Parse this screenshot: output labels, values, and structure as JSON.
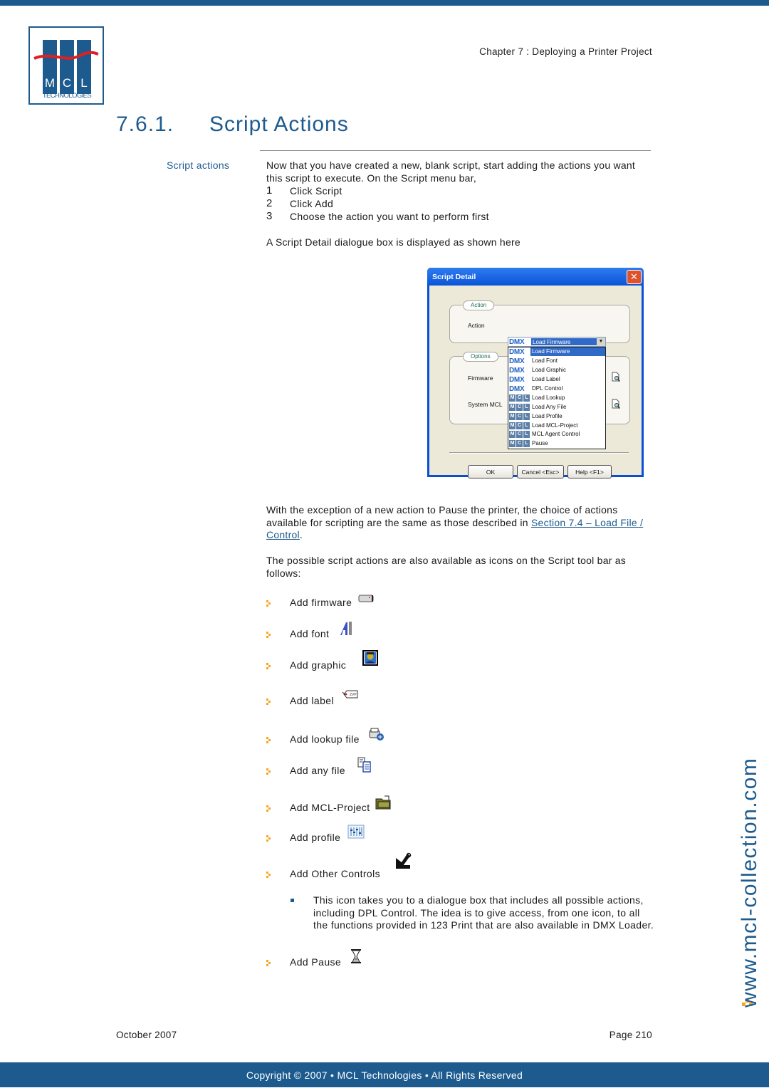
{
  "header": {
    "logo": {
      "letters": [
        "M",
        "C",
        "L"
      ],
      "subtitle": "TECHNOLOGIES"
    },
    "running_head": "Chapter 7 : Deploying a Printer Project"
  },
  "section": {
    "number": "7.6.1.",
    "title": "Script Actions",
    "side_label": "Script actions"
  },
  "intro": {
    "paragraph": "Now that you have created a new, blank script, start adding the actions you want this script to execute. On the Script menu bar,",
    "steps": [
      {
        "num": "1",
        "text": "Click Script"
      },
      {
        "num": "2",
        "text": "Click Add"
      },
      {
        "num": "3",
        "text": "Choose the action you want to perform first"
      }
    ],
    "dialog_caption": "A Script Detail dialogue box is displayed as shown here"
  },
  "dialog": {
    "title": "Script Detail",
    "close_glyph": "✕",
    "action_group_label": "Action",
    "action_label": "Action",
    "selected_action": {
      "badge": "DMX",
      "text": "Load Firmware"
    },
    "options_group_label": "Options",
    "firmware_label": "Firmware",
    "system_mcl_label": "System MCL",
    "dropdown_items": [
      {
        "badge": "DMX",
        "text": "Load Firmware",
        "selected": true
      },
      {
        "badge": "DMX",
        "text": "Load Font"
      },
      {
        "badge": "DMX",
        "text": "Load Graphic"
      },
      {
        "badge": "DMX",
        "text": "Load Label"
      },
      {
        "badge": "DMX",
        "text": "DPL Control"
      },
      {
        "badge": "MCL",
        "text": "Load Lookup"
      },
      {
        "badge": "MCL",
        "text": "Load Any File"
      },
      {
        "badge": "MCL",
        "text": "Load Profile"
      },
      {
        "badge": "MCL",
        "text": "Load MCL-Project"
      },
      {
        "badge": "MCL",
        "text": "MCL Agent Control"
      },
      {
        "badge": "MCL",
        "text": "Pause"
      }
    ],
    "buttons": {
      "ok": "OK",
      "cancel": "Cancel <Esc>",
      "help": "Help <F1>"
    }
  },
  "body": {
    "exception_paragraph": "With the exception of a new action to Pause the printer, the choice of actions available for scripting are the same as those described in",
    "link_text": "Section 7.4 – Load File / Control",
    "link_suffix": ".",
    "toolbar_paragraph": "The possible script actions are also available as icons on the Script tool bar as follows:"
  },
  "toolbar_items": [
    {
      "label": "Add firmware",
      "icon": "firmware-icon"
    },
    {
      "label": "Add font",
      "icon": "font-icon"
    },
    {
      "label": "Add graphic",
      "icon": "graphic-icon"
    },
    {
      "label": "Add label",
      "icon": "label-icon"
    },
    {
      "label": "Add lookup file",
      "icon": "lookup-file-icon"
    },
    {
      "label": "Add any file",
      "icon": "any-file-icon"
    },
    {
      "label": "Add MCL-Project",
      "icon": "mcl-project-icon"
    },
    {
      "label": "Add profile",
      "icon": "profile-icon"
    },
    {
      "label": "Add Other Controls",
      "icon": "other-controls-icon"
    },
    {
      "label": "Add Pause",
      "icon": "hourglass-icon"
    }
  ],
  "other_controls_note": "This icon takes you to a dialogue box that includes all possible actions, including DPL Control. The idea is to give access, from one icon, to all the functions provided in 123 Print that are also available in DMX Loader.",
  "watermark": "www.mcl-collection.com",
  "footer": {
    "date": "October 2007",
    "page": "Page 210",
    "copyright": "Copyright © 2007 • MCL Technologies • All Rights Reserved"
  },
  "colors": {
    "brand_blue": "#1d5b8f",
    "accent_orange": "#f5a623",
    "logo_red": "#e02020"
  }
}
